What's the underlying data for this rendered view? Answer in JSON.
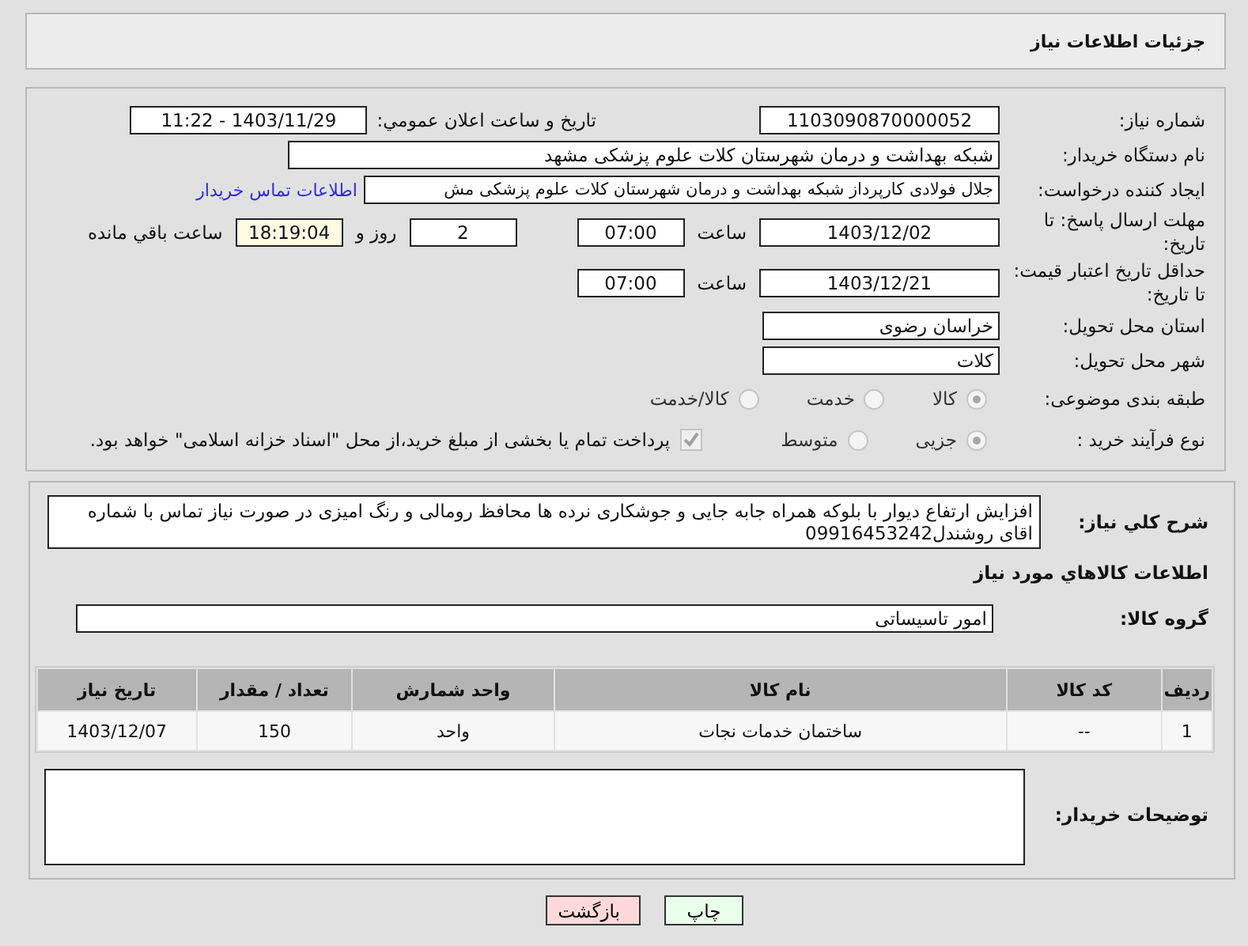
{
  "header": {
    "title": "جزئیات اطلاعات نیاز"
  },
  "need_number": {
    "label": "شماره نیاز:",
    "value": "1103090870000052"
  },
  "announce": {
    "label": "تاریخ و ساعت اعلان عمومي:",
    "value": "1403/11/29 - 11:22"
  },
  "buyer_org": {
    "label": "نام دستگاه خریدار:",
    "value": "شبکه بهداشت و درمان شهرستان کلات   علوم پزشکی مشهد"
  },
  "requester": {
    "label": "ایجاد کننده درخواست:",
    "value": "جلال فولادی کارپرداز شبکه بهداشت و درمان شهرستان کلات   علوم پزشکی مش",
    "link": "اطلاعات تماس خریدار"
  },
  "reply_deadline": {
    "label": "مهلت ارسال پاسخ: تا تاریخ:",
    "date": "1403/12/02",
    "time_label": "ساعت",
    "time": "07:00",
    "days": "2",
    "days_label": "روز و",
    "remaining": "18:19:04",
    "remaining_label": "ساعت باقي مانده"
  },
  "price_validity": {
    "label": "حداقل تاریخ اعتبار قیمت: تا تاریخ:",
    "date": "1403/12/21",
    "time_label": "ساعت",
    "time": "07:00"
  },
  "province": {
    "label": "استان محل تحویل:",
    "value": "خراسان رضوی"
  },
  "city": {
    "label": "شهر محل تحویل:",
    "value": "کلات"
  },
  "category": {
    "label": "طبقه بندی موضوعی:",
    "options": [
      {
        "label": "کالا",
        "selected": true
      },
      {
        "label": "خدمت",
        "selected": false
      },
      {
        "label": "کالا/خدمت",
        "selected": false
      }
    ]
  },
  "purchase_type": {
    "label": "نوع فرآیند خرید :",
    "options": [
      {
        "label": "جزیی",
        "selected": true
      },
      {
        "label": "متوسط",
        "selected": false
      }
    ],
    "treasury": {
      "checked": true,
      "text": "پرداخت تمام یا بخشی از مبلغ خرید،از محل \"اسناد خزانه اسلامی\" خواهد بود."
    }
  },
  "description": {
    "label": "شرح کلي نیاز:",
    "value": "افزایش ارتفاع دیوار با بلوکه همراه جابه جایی و جوشکاری نرده ها محافظ  رومالی و رنگ امیزی در صورت نیاز تماس با شماره اقای روشندل09916453242"
  },
  "goods_heading": "اطلاعات کالاهاي مورد نیاز",
  "goods_group": {
    "label": "گروه کالا:",
    "value": "امور تاسیساتی"
  },
  "table": {
    "columns": [
      "ردیف",
      "کد کالا",
      "نام کالا",
      "واحد شمارش",
      "تعداد / مقدار",
      "تاریخ نیاز"
    ],
    "rows": [
      [
        "1",
        "--",
        "ساختمان خدمات نجات",
        "واحد",
        "150",
        "1403/12/07"
      ]
    ]
  },
  "buyer_notes": {
    "label": "توضیحات خریدار:"
  },
  "buttons": [
    {
      "label": "چاپ",
      "kind": "print"
    },
    {
      "label": "بازگشت",
      "kind": "back"
    }
  ]
}
